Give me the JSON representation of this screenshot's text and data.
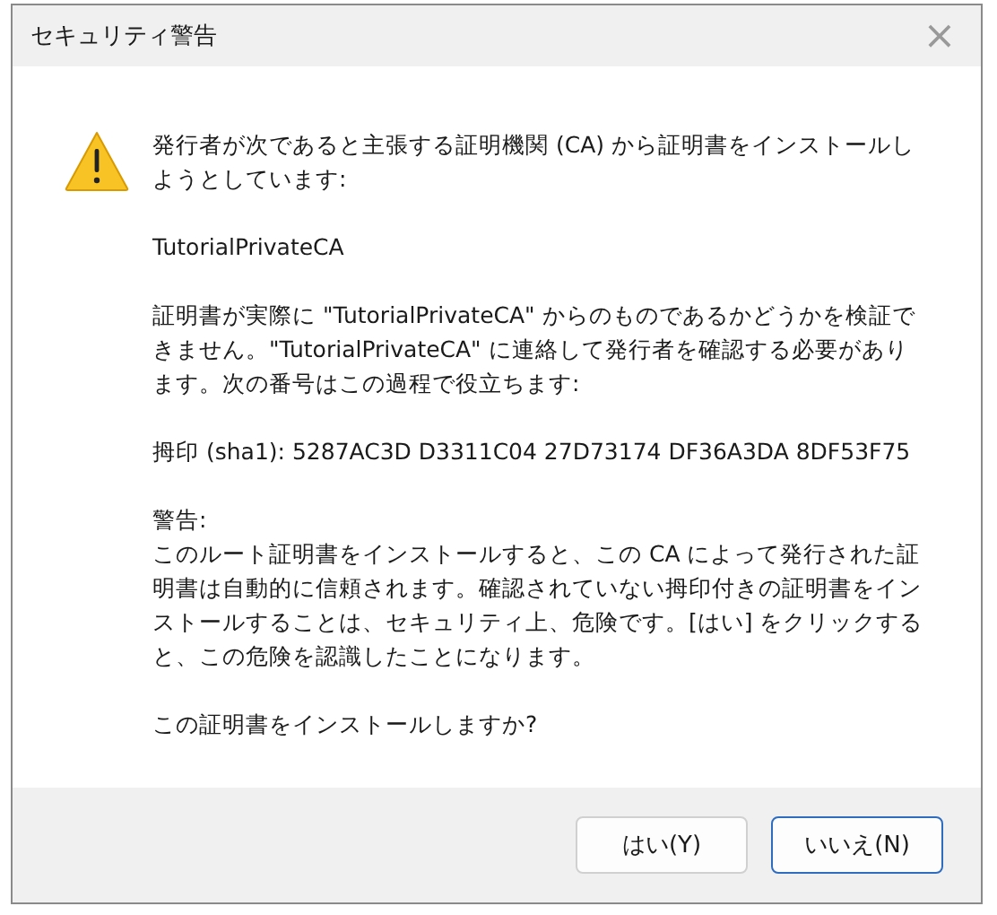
{
  "window": {
    "title": "セキュリティ警告",
    "close": "×"
  },
  "message": {
    "intro": "発行者が次であると主張する証明機関 (CA) から証明書をインストールしようとしています:",
    "ca_name": "TutorialPrivateCA",
    "verify": "証明書が実際に \"TutorialPrivateCA\" からのものであるかどうかを検証できません。\"TutorialPrivateCA\" に連絡して発行者を確認する必要があります。次の番号はこの過程で役立ちます:",
    "thumbprint": "拇印 (sha1): 5287AC3D D3311C04 27D73174 DF36A3DA 8DF53F75",
    "warning_heading": "警告:",
    "warning": "このルート証明書をインストールすると、この CA によって発行された証明書は自動的に信頼されます。確認されていない拇印付きの証明書をインストールすることは、セキュリティ上、危険です。[はい] をクリックすると、この危険を認識したことになります。",
    "question": "この証明書をインストールしますか?"
  },
  "buttons": [
    {
      "label": "はい(Y)",
      "focused": false
    },
    {
      "label": "いいえ(N)",
      "focused": true
    }
  ]
}
